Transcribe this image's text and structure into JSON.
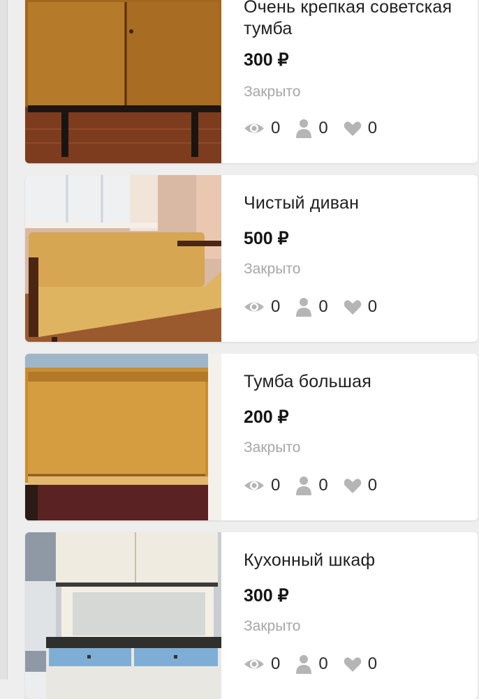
{
  "listings": [
    {
      "title": "Очень крепкая советская тумба",
      "price": "300 ₽",
      "status": "Закрыто",
      "views": "0",
      "contacts": "0",
      "likes": "0",
      "image": "soviet-cabinet-photo"
    },
    {
      "title": "Чистый диван",
      "price": "500 ₽",
      "status": "Закрыто",
      "views": "0",
      "contacts": "0",
      "likes": "0",
      "image": "sofa-photo"
    },
    {
      "title": "Тумба большая",
      "price": "200 ₽",
      "status": "Закрыто",
      "views": "0",
      "contacts": "0",
      "likes": "0",
      "image": "large-cabinet-photo"
    },
    {
      "title": "Кухонный шкаф",
      "price": "300 ₽",
      "status": "Закрыто",
      "views": "0",
      "contacts": "0",
      "likes": "0",
      "image": "kitchen-cupboard-photo"
    }
  ],
  "icons": {
    "views": "eye-icon",
    "contacts": "person-icon",
    "likes": "heart-icon"
  },
  "colors": {
    "status": "#a6a6a6",
    "icon": "#b5b5b5",
    "card": "#ffffff",
    "background": "#eeeeee"
  }
}
